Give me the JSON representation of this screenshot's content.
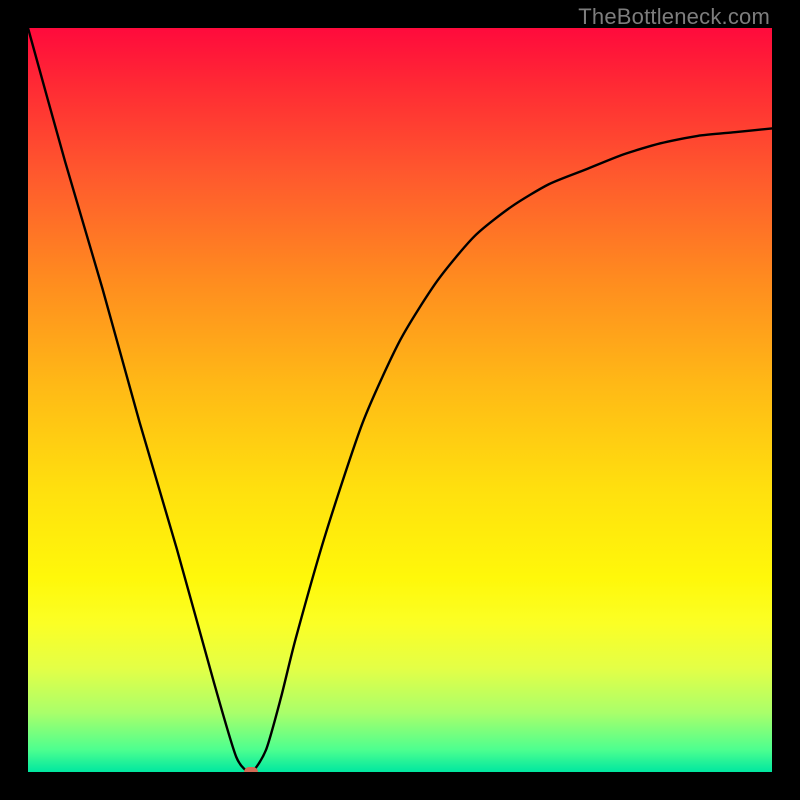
{
  "watermark": "TheBottleneck.com",
  "chart_data": {
    "type": "line",
    "title": "",
    "xlabel": "",
    "ylabel": "",
    "xlim": [
      0,
      100
    ],
    "ylim": [
      0,
      100
    ],
    "x": [
      0,
      5,
      10,
      15,
      20,
      25,
      28,
      30,
      32,
      34,
      36,
      40,
      45,
      50,
      55,
      60,
      65,
      70,
      75,
      80,
      85,
      90,
      95,
      100
    ],
    "y": [
      100,
      82,
      65,
      47,
      30,
      12,
      2,
      0,
      3,
      10,
      18,
      32,
      47,
      58,
      66,
      72,
      76,
      79,
      81,
      83,
      84.5,
      85.5,
      86,
      86.5
    ],
    "min_point": {
      "x": 30,
      "y": 0
    },
    "gradient_top_color": "#ff0a3c",
    "gradient_bottom_color": "#00e7a0",
    "curve_color": "#000000",
    "marker_color": "#d36a56"
  },
  "layout": {
    "inner_width": 744,
    "inner_height": 744,
    "border_width": 28
  }
}
